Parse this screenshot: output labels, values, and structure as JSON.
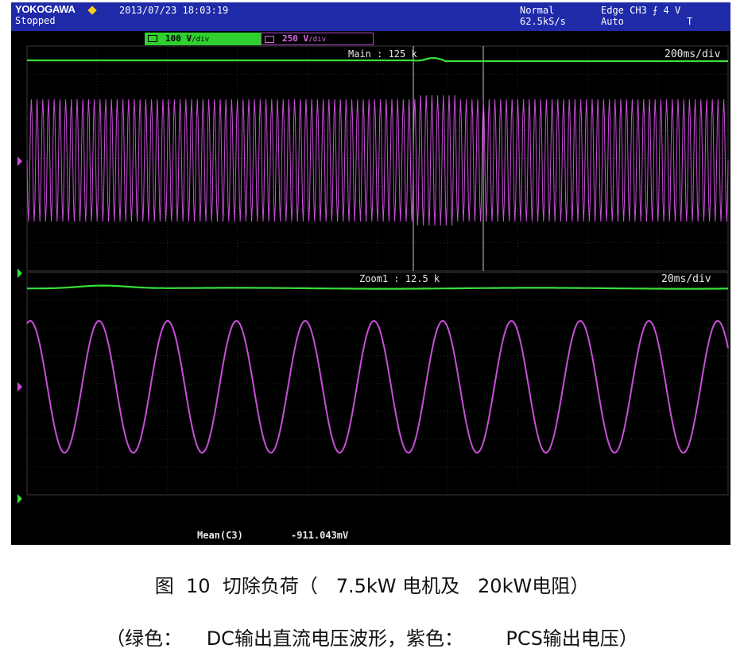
{
  "header": {
    "brand": "YOKOGAWA",
    "status": "Stopped",
    "datetime": "2013/07/23 18:03:19",
    "mode": "Normal",
    "sample_rate": "62.5kS/s",
    "trigger": "Edge CH3 ⨍ 4 V",
    "trigger_mode": "Auto",
    "corner_mark": "T"
  },
  "channels": [
    {
      "label": "100 V",
      "unit": "/div",
      "color": "#2fd02f"
    },
    {
      "label": "250 V",
      "unit": "/div",
      "color": "#c45ad6"
    }
  ],
  "main_window": {
    "label": "Main : 125 k",
    "timebase": "200ms/div"
  },
  "zoom_window": {
    "label": "Zoom1 : 12.5 k",
    "timebase": "20ms/div"
  },
  "measurement": {
    "name": "Mean(C3)",
    "value": "-911.043mV"
  },
  "colors": {
    "dc_trace": "#38e038",
    "pcs_trace": "#c84fd8",
    "header_bg": "#1f2aa8",
    "screen_bg": "#000000"
  },
  "caption": {
    "figure_line": "图  10  切除负荷（   7.5kW 电机及   20kW电阻）",
    "legend_line": "（绿色：    DC输出直流电压波形，紫色：       PCS输出电压）"
  }
}
